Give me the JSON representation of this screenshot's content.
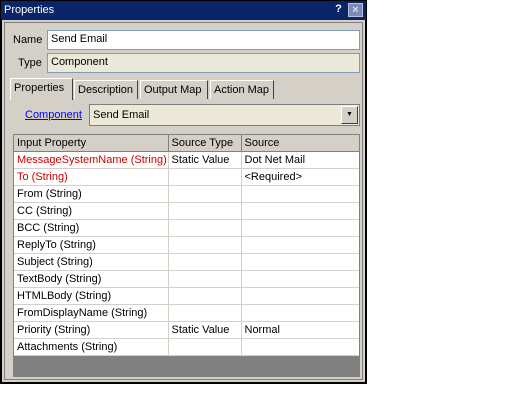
{
  "window": {
    "title": "Properties",
    "help_icon": "?",
    "close_icon": "×"
  },
  "form": {
    "name_label": "Name",
    "name_value": "Send Email",
    "type_label": "Type",
    "type_value": "Component"
  },
  "tabs": [
    {
      "label": "Properties",
      "active": true
    },
    {
      "label": "Description",
      "active": false
    },
    {
      "label": "Output Map",
      "active": false
    },
    {
      "label": "Action Map",
      "active": false
    }
  ],
  "component": {
    "link_label": "Component",
    "selected": "Send Email",
    "dropdown_icon": "▼"
  },
  "grid": {
    "columns": [
      "Input Property",
      "Source Type",
      "Source"
    ],
    "rows": [
      {
        "property": "MessageSystemName (String)",
        "source_type": "Static Value",
        "source": "Dot Net Mail",
        "required": true
      },
      {
        "property": "To (String)",
        "source_type": "",
        "source": "<Required>",
        "required": true
      },
      {
        "property": "From (String)",
        "source_type": "",
        "source": "",
        "required": false
      },
      {
        "property": "CC (String)",
        "source_type": "",
        "source": "",
        "required": false
      },
      {
        "property": "BCC (String)",
        "source_type": "",
        "source": "",
        "required": false
      },
      {
        "property": "ReplyTo (String)",
        "source_type": "",
        "source": "",
        "required": false
      },
      {
        "property": "Subject (String)",
        "source_type": "",
        "source": "",
        "required": false
      },
      {
        "property": "TextBody (String)",
        "source_type": "",
        "source": "",
        "required": false
      },
      {
        "property": "HTMLBody (String)",
        "source_type": "",
        "source": "",
        "required": false
      },
      {
        "property": "FromDisplayName (String)",
        "source_type": "",
        "source": "",
        "required": false
      },
      {
        "property": "Priority (String)",
        "source_type": "Static Value",
        "source": "Normal",
        "required": false
      },
      {
        "property": "Attachments (String)",
        "source_type": "",
        "source": "",
        "required": false
      }
    ]
  },
  "colors": {
    "titlebar": "#0a246a",
    "required_text": "#cc0000",
    "link": "#0000ff",
    "face": "#d4d0c8"
  }
}
